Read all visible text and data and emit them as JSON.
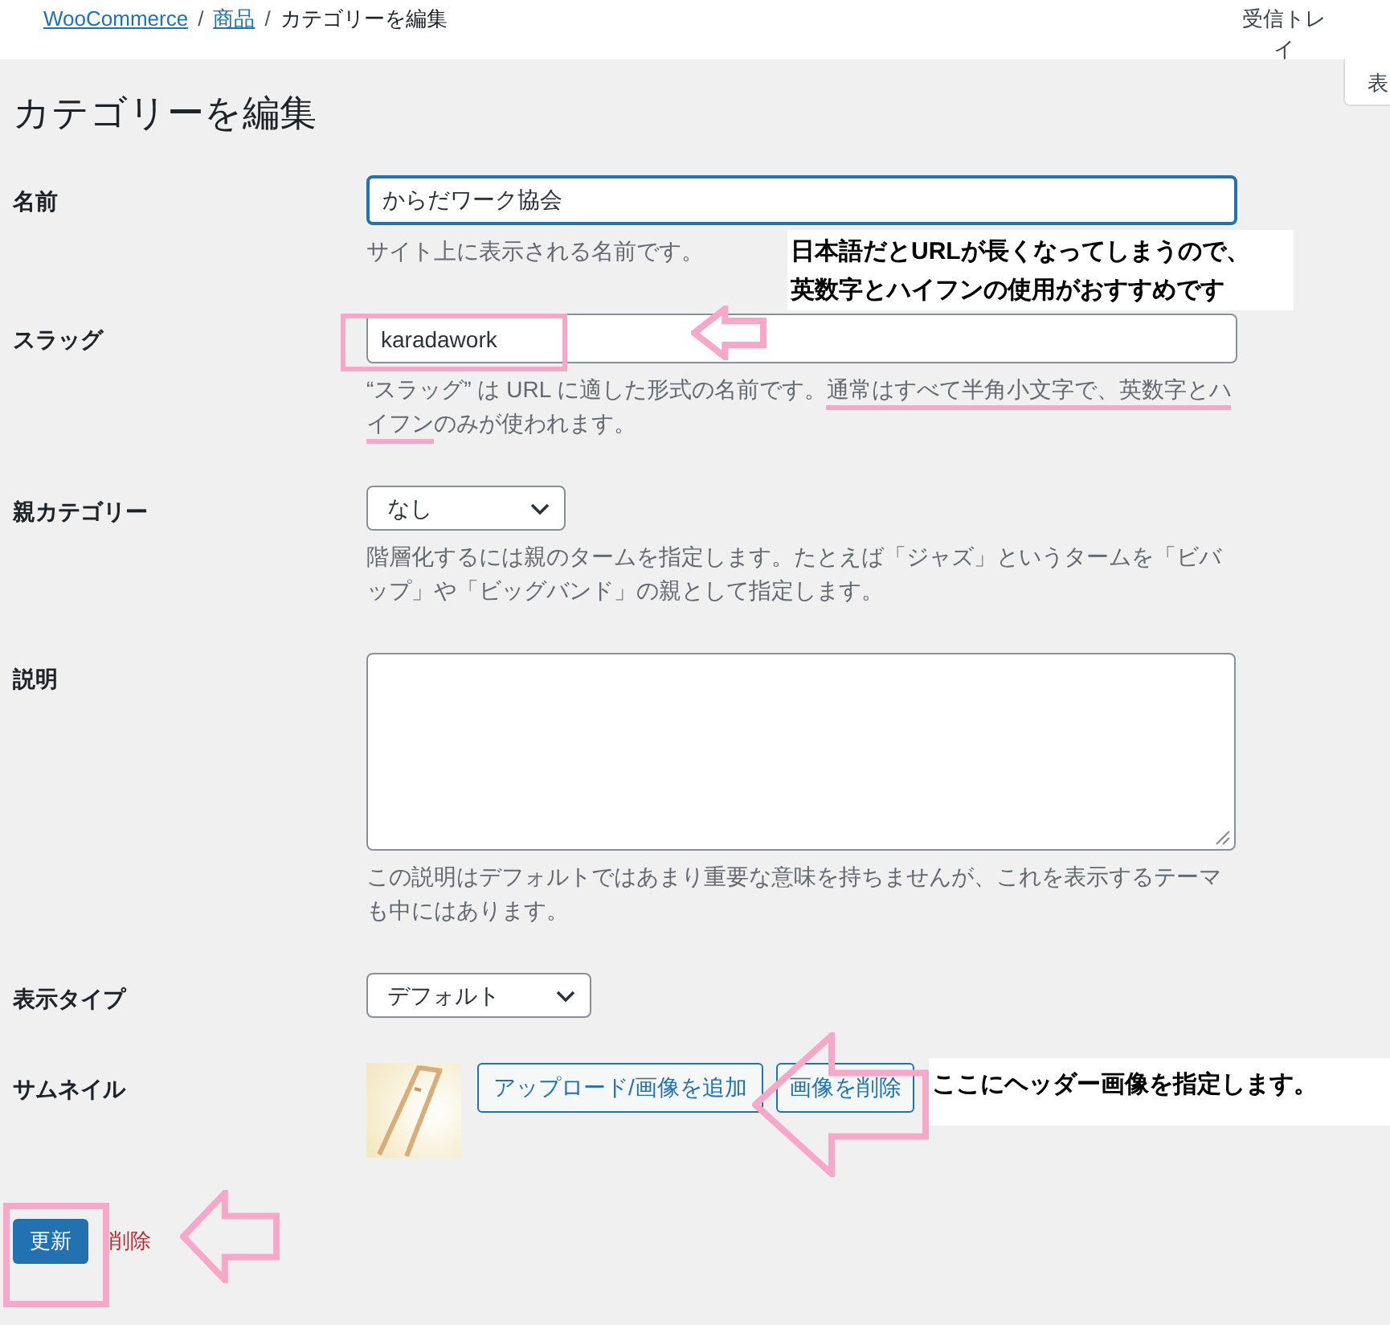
{
  "breadcrumb": [
    {
      "label": "WooCommerce",
      "link": true
    },
    {
      "label": "商品",
      "link": true
    },
    {
      "label": "カテゴリーを編集",
      "link": false
    }
  ],
  "separator": "/",
  "inbox": "受信トレイ",
  "side_tab": "表",
  "title": "カテゴリーを編集",
  "fields": [
    {
      "kind": "text",
      "label": "名前",
      "value": "からだワーク協会",
      "focused": true,
      "help": [
        {
          "text": "サイト上に表示される名前です。",
          "highlighted": false
        }
      ]
    },
    {
      "kind": "text",
      "label": "スラッグ",
      "value": "karadawork",
      "focused": false,
      "help": [
        {
          "text": "“スラッグ” は URL に適した形式の名前です。",
          "highlighted": false
        },
        {
          "text": "通常はすべて半角小文字で、英数字とハ",
          "highlighted": true
        },
        {
          "text": "イフン",
          "highlighted": true
        },
        {
          "text": "のみが使われます。",
          "highlighted": false
        }
      ]
    },
    {
      "kind": "select",
      "label": "親カテゴリー",
      "value": "なし",
      "help": [
        {
          "text": "階層化するには親のタームを指定します。たとえば「ジャズ」というタームを「ビバップ」や「ビッグバンド」の親として指定します。",
          "highlighted": false
        }
      ]
    },
    {
      "kind": "textarea",
      "label": "説明",
      "help": [
        {
          "text": "この説明はデフォルトではあまり重要な意味を持ちませんが、これを表示するテーマも中にはあります。",
          "highlighted": false
        }
      ]
    },
    {
      "kind": "select",
      "label": "表示タイプ",
      "value": "デフォルト"
    },
    {
      "label": "サムネイル",
      "buttons": [
        "アップロード/画像を追加",
        "画像を削除"
      ]
    }
  ],
  "actions": {
    "primary": "更新",
    "delete": "削除"
  },
  "callouts": [
    {
      "lines": [
        "日本語だとURLが長くなってしまうので、",
        "英数字とハイフンの使用がおすすめです"
      ]
    },
    {
      "lines": [
        "ここにヘッダー画像を指定します。"
      ]
    }
  ]
}
